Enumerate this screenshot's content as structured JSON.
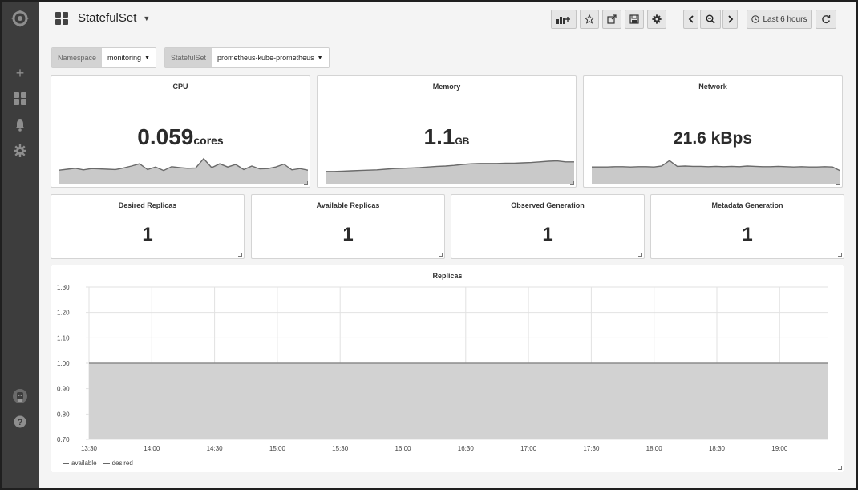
{
  "dashboard": {
    "title": "StatefulSet"
  },
  "toolbar": {
    "time_range": "Last 6 hours",
    "icons": [
      "add-panel-icon",
      "star-icon",
      "share-icon",
      "save-icon",
      "gear-icon",
      "chevron-left-icon",
      "zoom-out-icon",
      "chevron-right-icon",
      "clock-icon",
      "refresh-icon"
    ]
  },
  "sidebar": {
    "icons": [
      "grafana-logo",
      "plus-icon",
      "dashboards-icon",
      "alert-bell-icon",
      "gear-icon",
      "user-avatar-icon",
      "help-icon"
    ]
  },
  "variables": [
    {
      "label": "Namespace",
      "value": "monitoring"
    },
    {
      "label": "StatefulSet",
      "value": "prometheus-kube-prometheus"
    }
  ],
  "panels": {
    "cpu": {
      "title": "CPU",
      "value": "0.059",
      "unit": "cores",
      "spark": [
        0.42,
        0.45,
        0.48,
        0.43,
        0.47,
        0.46,
        0.45,
        0.44,
        0.49,
        0.55,
        0.62,
        0.44,
        0.52,
        0.41,
        0.53,
        0.5,
        0.48,
        0.49,
        0.78,
        0.5,
        0.62,
        0.52,
        0.6,
        0.44,
        0.55,
        0.46,
        0.47,
        0.52,
        0.61,
        0.43,
        0.47,
        0.42
      ]
    },
    "memory": {
      "title": "Memory",
      "value": "1.1",
      "unit": "GB",
      "spark": [
        0.38,
        0.38,
        0.39,
        0.4,
        0.41,
        0.42,
        0.43,
        0.45,
        0.47,
        0.48,
        0.49,
        0.5,
        0.52,
        0.54,
        0.55,
        0.57,
        0.6,
        0.62,
        0.63,
        0.63,
        0.63,
        0.64,
        0.64,
        0.65,
        0.66,
        0.68,
        0.7,
        0.71,
        0.68,
        0.68
      ]
    },
    "network": {
      "title": "Network",
      "value": "21.6 kBps",
      "spark": [
        0.52,
        0.52,
        0.52,
        0.53,
        0.53,
        0.52,
        0.53,
        0.53,
        0.52,
        0.55,
        0.72,
        0.54,
        0.55,
        0.54,
        0.54,
        0.53,
        0.54,
        0.53,
        0.54,
        0.53,
        0.55,
        0.54,
        0.53,
        0.53,
        0.54,
        0.53,
        0.52,
        0.53,
        0.52,
        0.52,
        0.53,
        0.52,
        0.4
      ]
    },
    "desired": {
      "title": "Desired Replicas",
      "value": "1"
    },
    "available": {
      "title": "Available Replicas",
      "value": "1"
    },
    "observed": {
      "title": "Observed Generation",
      "value": "1"
    },
    "metadata": {
      "title": "Metadata Generation",
      "value": "1"
    }
  },
  "chart_data": {
    "type": "area",
    "title": "Replicas",
    "x": [
      "13:30",
      "14:00",
      "14:30",
      "15:00",
      "15:30",
      "16:00",
      "16:30",
      "17:00",
      "17:30",
      "18:00",
      "18:30",
      "19:00"
    ],
    "series": [
      {
        "name": "available",
        "values": [
          1,
          1,
          1,
          1,
          1,
          1,
          1,
          1,
          1,
          1,
          1,
          1
        ]
      },
      {
        "name": "desired",
        "values": [
          1,
          1,
          1,
          1,
          1,
          1,
          1,
          1,
          1,
          1,
          1,
          1
        ]
      }
    ],
    "yticks": [
      "1.30",
      "1.20",
      "1.10",
      "1.00",
      "0.90",
      "0.80",
      "0.70"
    ],
    "ylim": [
      0.7,
      1.3
    ],
    "grid": true,
    "legend": "bottom-left"
  }
}
